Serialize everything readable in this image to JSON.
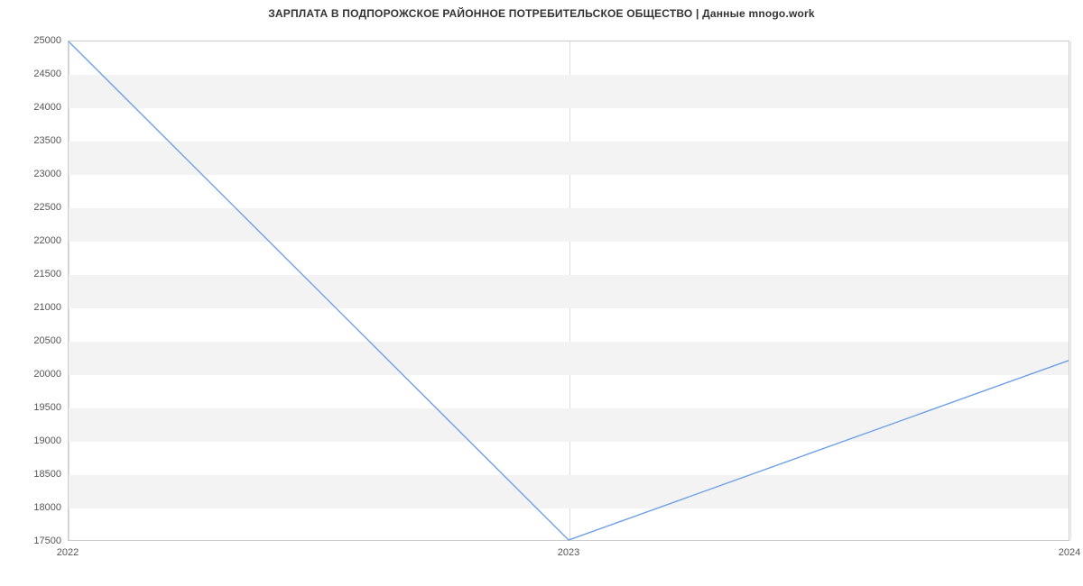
{
  "chart_data": {
    "type": "line",
    "title": "ЗАРПЛАТА В ПОДПОРОЖСКОЕ РАЙОННОЕ ПОТРЕБИТЕЛЬСКОЕ ОБЩЕСТВО | Данные mnogo.work",
    "x": [
      2022,
      2023,
      2024
    ],
    "values": [
      25000,
      17500,
      20200
    ],
    "xlabel": "",
    "ylabel": "",
    "x_ticks": [
      2022,
      2023,
      2024
    ],
    "y_ticks": [
      17500,
      18000,
      18500,
      19000,
      19500,
      20000,
      20500,
      21000,
      21500,
      22000,
      22500,
      23000,
      23500,
      24000,
      24500,
      25000
    ],
    "xlim": [
      2022,
      2024
    ],
    "ylim": [
      17500,
      25000
    ],
    "grid": true
  }
}
